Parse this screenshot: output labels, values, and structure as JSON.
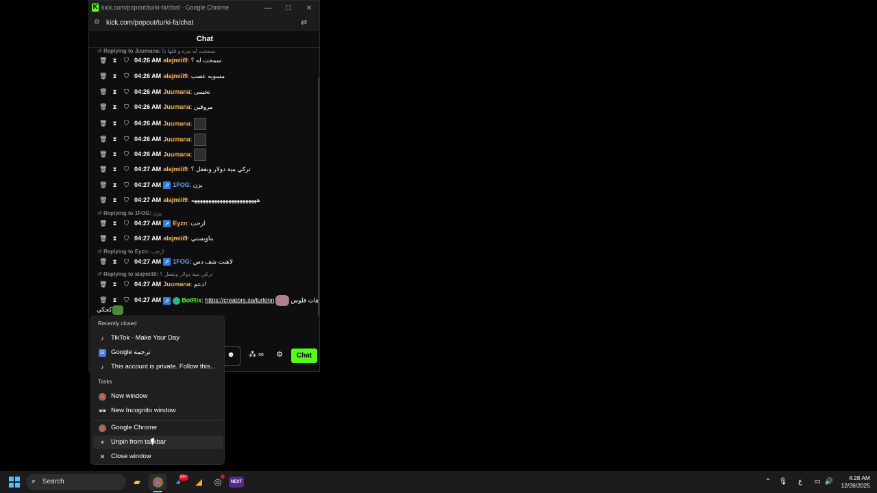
{
  "window": {
    "title": "kick.com/popout/turki-fa/chat - Google Chrome",
    "url": "kick.com/popout/turki-fa/chat",
    "min": "—",
    "max": "☐",
    "close": "✕",
    "chat_header": "Chat"
  },
  "messages": [
    {
      "type": "reply",
      "label": "Replying to Juumana:",
      "quote": "سمحت له مره و قلها ذا"
    },
    {
      "type": "msg",
      "time": "04:26 AM",
      "user": "alajmiii9",
      "color": "orange",
      "text": "سمحت له ؟"
    },
    {
      "type": "msg",
      "time": "04:26 AM",
      "user": "alajmiii9",
      "color": "orange",
      "text": "مسويه عصب"
    },
    {
      "type": "msg",
      "time": "04:26 AM",
      "user": "Juumana",
      "color": "orange",
      "text": "تخسى"
    },
    {
      "type": "msg",
      "time": "04:26 AM",
      "user": "Juumana",
      "color": "orange",
      "text": "مروقين"
    },
    {
      "type": "msg",
      "time": "04:26 AM",
      "user": "Juumana",
      "color": "orange",
      "text": ""
    },
    {
      "type": "msg",
      "time": "04:26 AM",
      "user": "Juumana",
      "color": "orange",
      "text": ""
    },
    {
      "type": "msg",
      "time": "04:26 AM",
      "user": "Juumana",
      "color": "orange",
      "text": ""
    },
    {
      "type": "msg",
      "time": "04:27 AM",
      "user": "alajmiii9",
      "color": "orange",
      "text": "تركي مية دولار ونقفل ؟"
    },
    {
      "type": "msg",
      "time": "04:27 AM",
      "user": "1FOG",
      "color": "blue",
      "text": "يزن"
    },
    {
      "type": "msg",
      "time": "04:27 AM",
      "user": "alajmiii9",
      "color": "orange",
      "text": "هههههههههههههههههههههههه"
    },
    {
      "type": "reply",
      "label": "Replying to 1FOG:",
      "quote": "يزن"
    },
    {
      "type": "msg",
      "time": "04:27 AM",
      "user": "Eyzn",
      "color": "orange",
      "text": "ارحب"
    },
    {
      "type": "msg",
      "time": "04:27 AM",
      "user": "alajmiii9",
      "color": "orange",
      "text": "بناويستي"
    },
    {
      "type": "reply",
      "label": "Replying to Eyzn:",
      "quote": "ارحب"
    },
    {
      "type": "msg",
      "time": "04:27 AM",
      "user": "1FOG",
      "color": "blue",
      "text": "لاهنت شف دس"
    },
    {
      "type": "reply",
      "label": "Replying to alajmiii9:",
      "quote": "تركي مية دولار ونقفل ؟"
    },
    {
      "type": "msg",
      "time": "04:27 AM",
      "user": "Juumana",
      "color": "orange",
      "text": "دعم!"
    },
    {
      "type": "msg",
      "time": "04:27 AM",
      "user": "BotRix",
      "color": "green",
      "link": "https://creators.sa/turkinn",
      "text": "هات فلوس",
      "text2": "كحكي"
    }
  ],
  "input": {
    "chat_button": "Chat",
    "emoji_icon": "emoji-icon",
    "infinity_label": "∞"
  },
  "jumplist": {
    "recent_header": "Recently closed",
    "recent": [
      {
        "label": "TikTok - Make Your Day",
        "icon": "tiktok-icon"
      },
      {
        "label": "Google ترجمة",
        "icon": "google-translate-icon"
      },
      {
        "label": "This account is private. Follow this...",
        "icon": "tiktok-icon"
      }
    ],
    "tasks_header": "Tasks",
    "tasks": [
      {
        "label": "New window",
        "icon": "chrome-icon"
      },
      {
        "label": "New Incognito window",
        "icon": "incognito-icon"
      }
    ],
    "app": {
      "label": "Google Chrome",
      "icon": "chrome-icon"
    },
    "unpin": {
      "label": "Unpin from taskbar",
      "icon": "unpin-icon"
    },
    "close": {
      "label": "Close window",
      "icon": "close-icon"
    }
  },
  "taskbar": {
    "search_label": "Search",
    "clock_time": "4:28 AM",
    "clock_date": "12/28/2025",
    "lang": "ع",
    "discord_badge": "99+"
  },
  "colors": {
    "kick_green": "#53fc18",
    "orange_user": "#ffb74d",
    "blue_user": "#5aa9ff"
  }
}
